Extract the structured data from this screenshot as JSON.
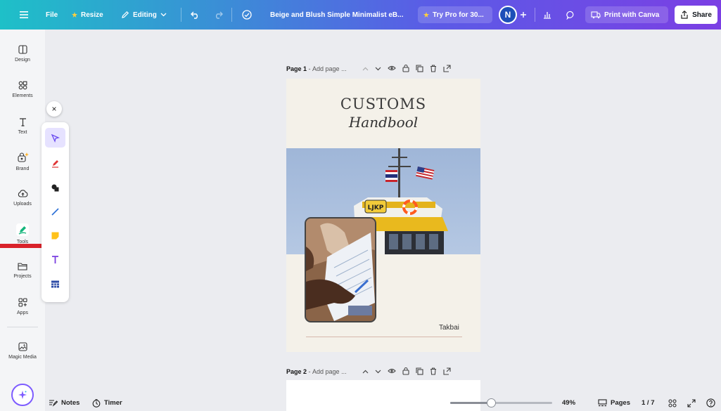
{
  "topbar": {
    "menu_icon": "hamburger-icon",
    "file_label": "File",
    "resize_label": "Resize",
    "editing_label": "Editing",
    "doc_title": "Beige and Blush Simple Minimalist eB...",
    "try_pro_label": "Try Pro for 30...",
    "avatar_initial": "N",
    "print_label": "Print with Canva",
    "share_label": "Share",
    "colors": {
      "gradient_start": "#1ec0c8",
      "gradient_end": "#7b3fe4"
    }
  },
  "sidebar": {
    "items": [
      {
        "label": "Design",
        "icon": "design-icon"
      },
      {
        "label": "Elements",
        "icon": "elements-icon"
      },
      {
        "label": "Text",
        "icon": "text-icon"
      },
      {
        "label": "Brand",
        "icon": "brand-icon"
      },
      {
        "label": "Uploads",
        "icon": "uploads-icon"
      },
      {
        "label": "Tools",
        "icon": "tools-icon"
      },
      {
        "label": "Projects",
        "icon": "projects-icon"
      },
      {
        "label": "Apps",
        "icon": "apps-icon"
      },
      {
        "label": "Magic Media",
        "icon": "magic-media-icon"
      }
    ]
  },
  "tools_panel": {
    "close_glyph": "×",
    "tools": [
      {
        "name": "select",
        "icon": "cursor-icon",
        "active": true
      },
      {
        "name": "pen",
        "icon": "pen-icon"
      },
      {
        "name": "shapes",
        "icon": "shapes-icon"
      },
      {
        "name": "line",
        "icon": "line-icon"
      },
      {
        "name": "sticky",
        "icon": "sticky-note-icon"
      },
      {
        "name": "text",
        "icon": "text-tool-icon"
      },
      {
        "name": "table",
        "icon": "table-icon"
      }
    ]
  },
  "pages": [
    {
      "number_label": "Page 1",
      "dash": " - ",
      "title_placeholder": "Add page ..."
    },
    {
      "number_label": "Page 2",
      "dash": " - ",
      "title_placeholder": "Add page ..."
    }
  ],
  "design": {
    "title": "CUSTOMS",
    "subtitle": "Handbool",
    "author": "Takbai",
    "boat_sign": "LJKP",
    "colors": {
      "page_bg": "#f4f1e9",
      "rule": "#d6b8ad"
    }
  },
  "bottombar": {
    "notes_label": "Notes",
    "timer_label": "Timer",
    "zoom_label": "49%",
    "zoom_fraction": 0.4,
    "pages_label": "Pages",
    "page_count": "1 / 7"
  }
}
